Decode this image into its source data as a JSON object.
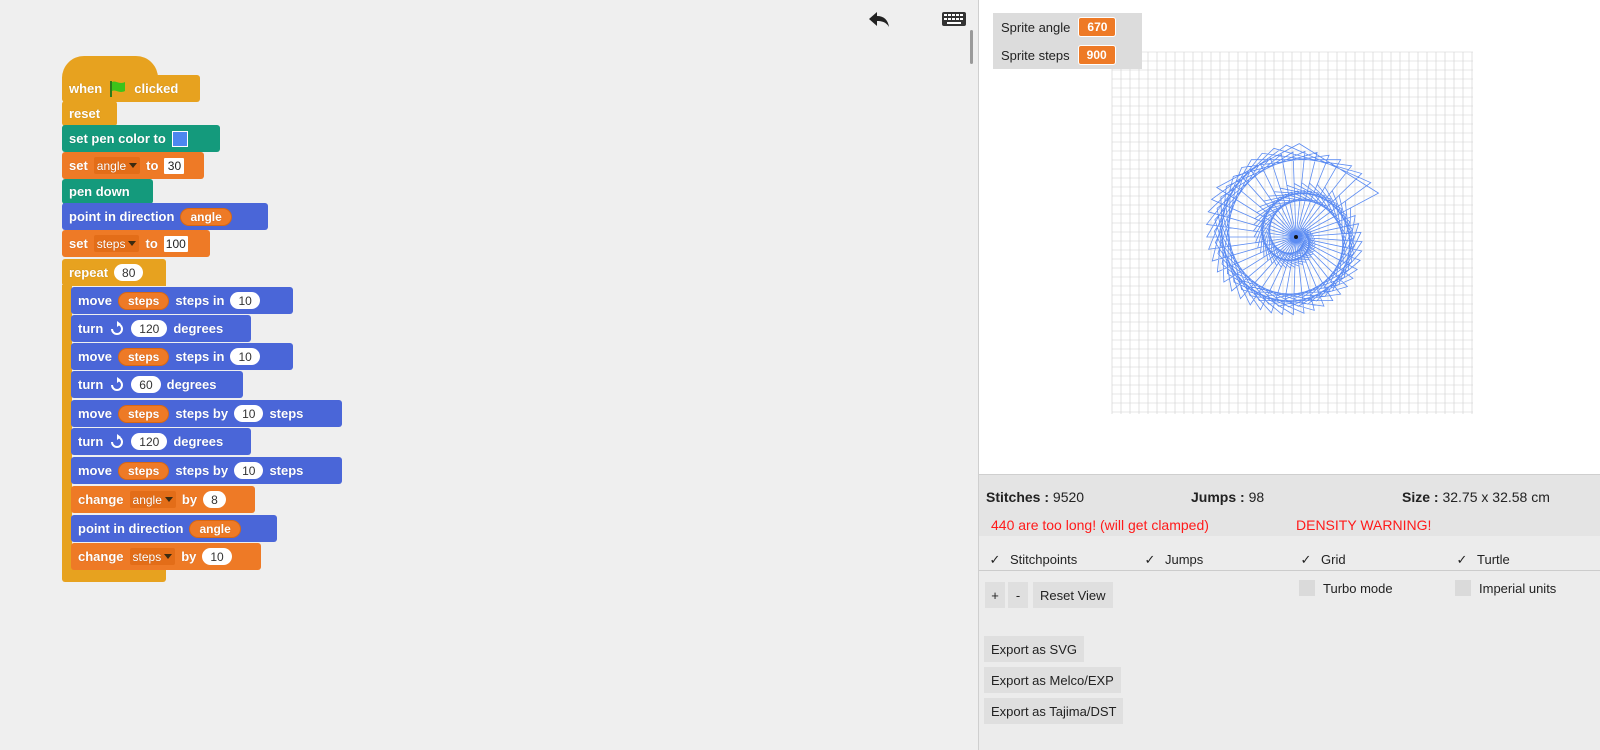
{
  "script": {
    "hat": {
      "when": "when",
      "clicked": "clicked"
    },
    "reset": "reset",
    "set_pen_color": {
      "label": "set pen color to",
      "color": "#4d87f0"
    },
    "set_angle": {
      "set": "set",
      "var": "angle",
      "to": "to",
      "value": "30"
    },
    "pen_down": "pen down",
    "point_direction_1": {
      "label": "point in direction",
      "var": "angle"
    },
    "set_steps": {
      "set": "set",
      "var": "steps",
      "to": "to",
      "value": "100"
    },
    "repeat": {
      "label": "repeat",
      "count": "80"
    },
    "move_1": {
      "move": "move",
      "var": "steps",
      "mid": "steps in",
      "value": "10"
    },
    "turn_1": {
      "turn": "turn",
      "value": "120",
      "unit": "degrees"
    },
    "move_2": {
      "move": "move",
      "var": "steps",
      "mid": "steps in",
      "value": "10"
    },
    "turn_2": {
      "turn": "turn",
      "value": "60",
      "unit": "degrees"
    },
    "move_3": {
      "move": "move",
      "var": "steps",
      "mid": "steps by",
      "value": "10",
      "end": "steps"
    },
    "turn_3": {
      "turn": "turn",
      "value": "120",
      "unit": "degrees"
    },
    "move_4": {
      "move": "move",
      "var": "steps",
      "mid": "steps by",
      "value": "10",
      "end": "steps"
    },
    "change_angle": {
      "change": "change",
      "var": "angle",
      "by": "by",
      "value": "8"
    },
    "point_direction_2": {
      "label": "point in direction",
      "var": "angle"
    },
    "change_steps": {
      "change": "change",
      "var": "steps",
      "by": "by",
      "value": "10"
    }
  },
  "stage": {
    "watchers": [
      {
        "label": "Sprite angle",
        "value": "670"
      },
      {
        "label": "Sprite steps",
        "value": "900"
      }
    ],
    "drawing": {
      "repeat_count": 80,
      "start_angle": 30,
      "angle_change": 8,
      "start_steps": 100,
      "steps_change": 10,
      "pen_color": "#5c8cf2"
    }
  },
  "stats": {
    "stitches_label": "Stitches :",
    "stitches": "9520",
    "jumps_label": "Jumps :",
    "jumps": "98",
    "size_label": "Size :",
    "size": "32.75 x 32.58 cm",
    "warn_clamped": "440 are too long! (will get clamped)",
    "warn_density": "DENSITY WARNING!"
  },
  "options": {
    "stitchpoints": {
      "label": "Stitchpoints",
      "checked": true
    },
    "jumps": {
      "label": "Jumps",
      "checked": true
    },
    "grid": {
      "label": "Grid",
      "checked": true
    },
    "turtle": {
      "label": "Turtle",
      "checked": true
    },
    "turbo": {
      "label": "Turbo mode",
      "checked": false
    },
    "imperial": {
      "label": "Imperial units",
      "checked": false
    }
  },
  "view": {
    "zoom_in": "+",
    "zoom_out": "-",
    "reset": "Reset View"
  },
  "export": {
    "svg": "Export as SVG",
    "exp": "Export as Melco/EXP",
    "dst": "Export as Tajima/DST"
  }
}
